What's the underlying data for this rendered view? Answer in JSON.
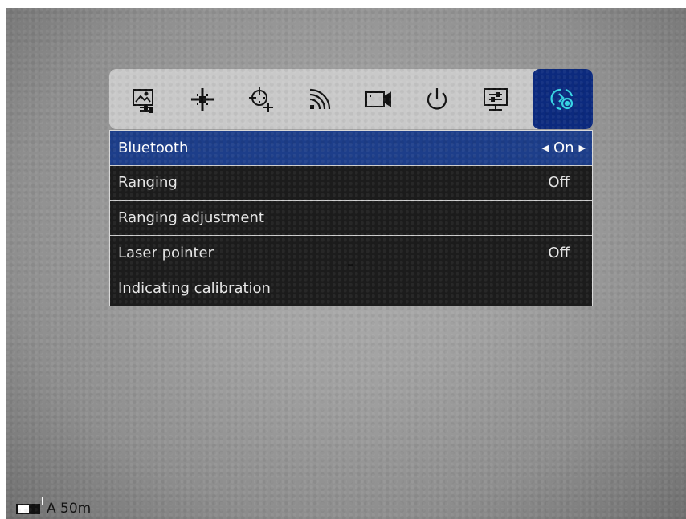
{
  "tabs": [
    {
      "icon": "image-settings-icon",
      "active": false
    },
    {
      "icon": "crosshair-icon",
      "active": false
    },
    {
      "icon": "reticle-add-icon",
      "active": false
    },
    {
      "icon": "signal-icon",
      "active": false
    },
    {
      "icon": "video-camera-icon",
      "active": false
    },
    {
      "icon": "power-icon",
      "active": false
    },
    {
      "icon": "display-settings-icon",
      "active": false
    },
    {
      "icon": "connectivity-settings-icon",
      "active": true
    }
  ],
  "menu": {
    "items": [
      {
        "label": "Bluetooth",
        "value": "On",
        "selected": true
      },
      {
        "label": "Ranging",
        "value": "Off",
        "selected": false
      },
      {
        "label": "Ranging adjustment",
        "value": "",
        "selected": false
      },
      {
        "label": "Laser pointer",
        "value": "Off",
        "selected": false
      },
      {
        "label": "Indicating calibration",
        "value": "",
        "selected": false
      }
    ]
  },
  "status": {
    "mode_distance": "A 50m"
  },
  "colors": {
    "selected_row": "#1d3e8a",
    "active_tab": "#0c2a7e",
    "active_icon": "#35d4e4",
    "row_bg": "#1c1c1c"
  }
}
